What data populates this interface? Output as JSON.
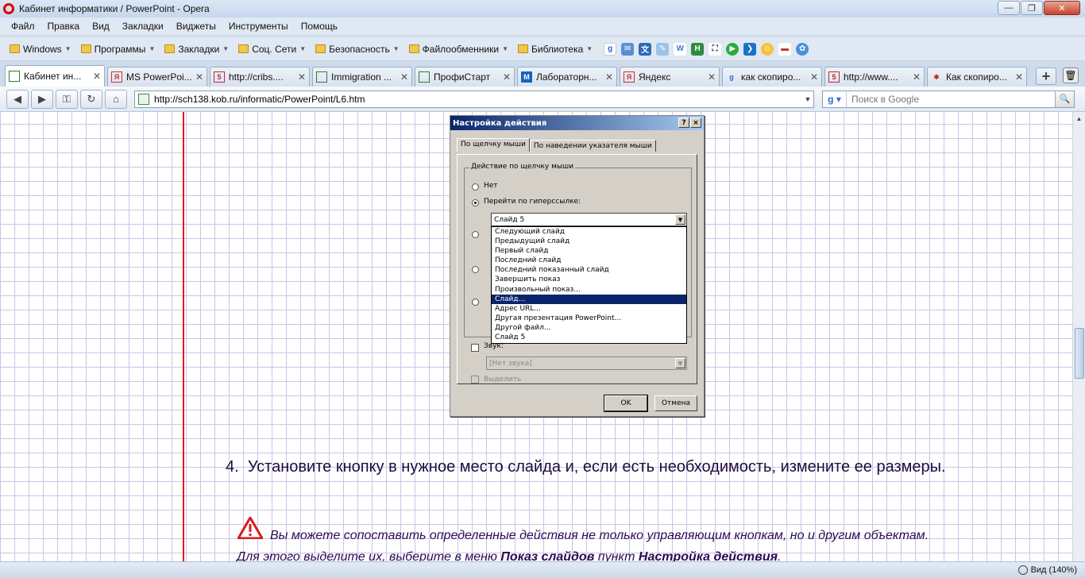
{
  "window": {
    "title": "Кабинет информатики / PowerPoint - Opera"
  },
  "menu": [
    "Файл",
    "Правка",
    "Вид",
    "Закладки",
    "Виджеты",
    "Инструменты",
    "Помощь"
  ],
  "bookmarks": [
    "Windows",
    "Программы",
    "Закладки",
    "Соц. Сети",
    "Безопасность",
    "Файлообменники",
    "Библиотека"
  ],
  "tabs": [
    {
      "label": "Кабинет ин...",
      "icon": "page-icon",
      "color": "#2e7d32"
    },
    {
      "label": "MS PowerPoi...",
      "icon": "yandex-icon",
      "color": "#d32f2f"
    },
    {
      "label": "http://cribs....",
      "icon": "page-icon",
      "color": "#c62828"
    },
    {
      "label": "Immigration ...",
      "icon": "page-icon",
      "color": "#2e7d32"
    },
    {
      "label": "ПрофиСтарт",
      "icon": "page-icon",
      "color": "#2e7d32"
    },
    {
      "label": "Лабораторн...",
      "icon": "m-icon",
      "color": "#1565c0"
    },
    {
      "label": "Яндекс",
      "icon": "yandex-icon",
      "color": "#d32f2f"
    },
    {
      "label": "как скопиро...",
      "icon": "google-icon",
      "color": "#3366cc"
    },
    {
      "label": "http://www....",
      "icon": "page-icon",
      "color": "#c62828"
    },
    {
      "label": "Как скопиро...",
      "icon": "bug-icon",
      "color": "#b71c1c"
    }
  ],
  "address": {
    "url": "http://sch138.kob.ru/informatic/PowerPoint/L6.htm"
  },
  "search": {
    "placeholder": "Поиск в Google"
  },
  "dialog": {
    "title": "Настройка действия",
    "help_btn": "?",
    "close_btn": "×",
    "tab_click": "По щелчку мыши",
    "tab_hover": "По наведении указателя мыши",
    "group_label": "Действие по щелчку мыши",
    "opt_none": "Нет",
    "opt_hyperlink": "Перейти по гиперссылке:",
    "hyperlink_value": "Слайд 5",
    "dropdown_items": [
      "Следующий слайд",
      "Предыдущий слайд",
      "Первый слайд",
      "Последний слайд",
      "Последний показанный слайд",
      "Завершить показ",
      "Произвольный показ...",
      "Слайд...",
      "Адрес URL...",
      "Другая презентация PowerPoint...",
      "Другой файл...",
      "Слайд 5"
    ],
    "selected_index": 7,
    "sound_label": "Звук:",
    "sound_value": "[Нет звука]",
    "highlight_label": "Выделить",
    "ok": "OK",
    "cancel": "Отмена"
  },
  "content": {
    "step_number": "4.",
    "step_text": "Установите кнопку в нужное место слайда и, если есть необходимость, измените ее размеры.",
    "note_before": "Вы можете сопоставить определенные действия не только управляющим кнопкам, но и другим объектам. Для этого выделите их, выберите в меню ",
    "note_bold1": "Показ слайдов",
    "note_middle": " пункт ",
    "note_bold2": "Настройка действия",
    "note_end": "."
  },
  "status": {
    "zoom": "Вид (140%)"
  },
  "colors": {
    "margin_line": "#e01b1b",
    "grid": "#c9c6e6",
    "text": "#1e0b3e",
    "dialog_selection": "#0a246a"
  }
}
